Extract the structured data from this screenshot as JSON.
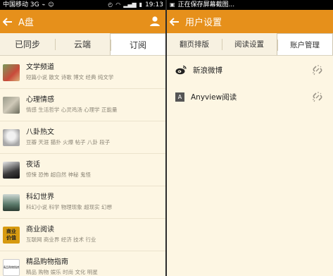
{
  "left": {
    "status": {
      "carrier": "中国移动 3G",
      "time": "19:13"
    },
    "appbar": {
      "title": "A盘"
    },
    "tabs": [
      "已同步",
      "云端",
      "订阅"
    ],
    "categories": [
      {
        "title": "文学频道",
        "subtitle": "短篇小说 散文 诗歌 博文 经典 纯文学"
      },
      {
        "title": "心理情感",
        "subtitle": "情感 生活哲学 心灵鸡汤 心理学 正能量"
      },
      {
        "title": "八卦热文",
        "subtitle": "豆瓣 天涯 猫扑 火爆 帖子 八卦 段子"
      },
      {
        "title": "夜话",
        "subtitle": "惊悚 恐怖 超自然 神秘 鬼怪"
      },
      {
        "title": "科幻世界",
        "subtitle": "科幻小说 科学 物理现象 超现实 幻想"
      },
      {
        "title": "商业阅读",
        "subtitle": "互联网 商业界 经济 技术 行业"
      },
      {
        "title": "精品购物指南",
        "subtitle": "精品 购物 娱乐 时尚 文化 明星"
      }
    ],
    "thumb_badge": "商业价值",
    "thumb_badge2": "精品购物指南"
  },
  "right": {
    "status": {
      "text": "正在保存屏幕截图..."
    },
    "appbar": {
      "title": "用户设置"
    },
    "tabs": [
      "翻页排版",
      "阅读设置",
      "账户管理"
    ],
    "accounts": [
      {
        "name": "新浪微博",
        "icon": "weibo-icon"
      },
      {
        "name": "Anyview阅读",
        "icon": "anyview-icon",
        "icon_letter": "A"
      }
    ]
  },
  "colors": {
    "accent": "#e6901b",
    "background": "#fdf6e3"
  }
}
